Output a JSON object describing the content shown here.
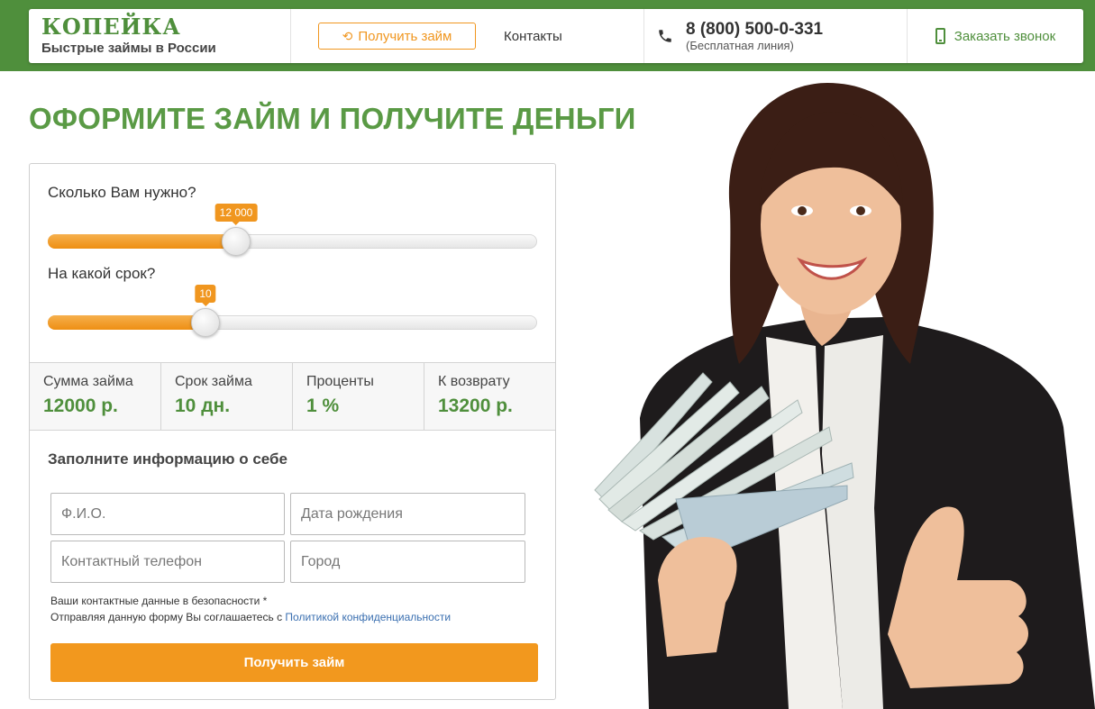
{
  "header": {
    "logo_text": "КОПЕЙКА",
    "slogan": "Быстрые займы в России",
    "get_loan_label": "Получить займ",
    "contacts_label": "Контакты",
    "phone": "8 (800) 500-0-331",
    "phone_note": "(Бесплатная линия)",
    "callback_label": "Заказать звонок"
  },
  "headline": "ОФОРМИТЕ ЗАЙМ И ПОЛУЧИТЕ ДЕНЬГИ",
  "calculator": {
    "amount_question": "Сколько Вам нужно?",
    "amount_value": "12 000",
    "amount_fraction": 0.385,
    "term_question": "На какой срок?",
    "term_value": "10",
    "term_fraction": 0.322
  },
  "summary": [
    {
      "label": "Сумма займа",
      "value": "12000 р."
    },
    {
      "label": "Срок займа",
      "value": "10 дн."
    },
    {
      "label": "Проценты",
      "value": "1 %"
    },
    {
      "label": "К возврату",
      "value": "13200 р."
    }
  ],
  "form": {
    "title": "Заполните информацию о себе",
    "name_placeholder": "Ф.И.О.",
    "birth_placeholder": "Дата рождения",
    "phone_placeholder": "Контактный телефон",
    "city_placeholder": "Город",
    "safety_note": "Ваши контактные данные в безопасности *",
    "consent_prefix": "Отправляя данную форму Вы соглашаетесь с",
    "privacy_link": "Политикой конфиденциальности",
    "submit_label": "Получить займ"
  },
  "colors": {
    "brand_green": "#4f8f3c",
    "accent_orange": "#f0961f"
  }
}
